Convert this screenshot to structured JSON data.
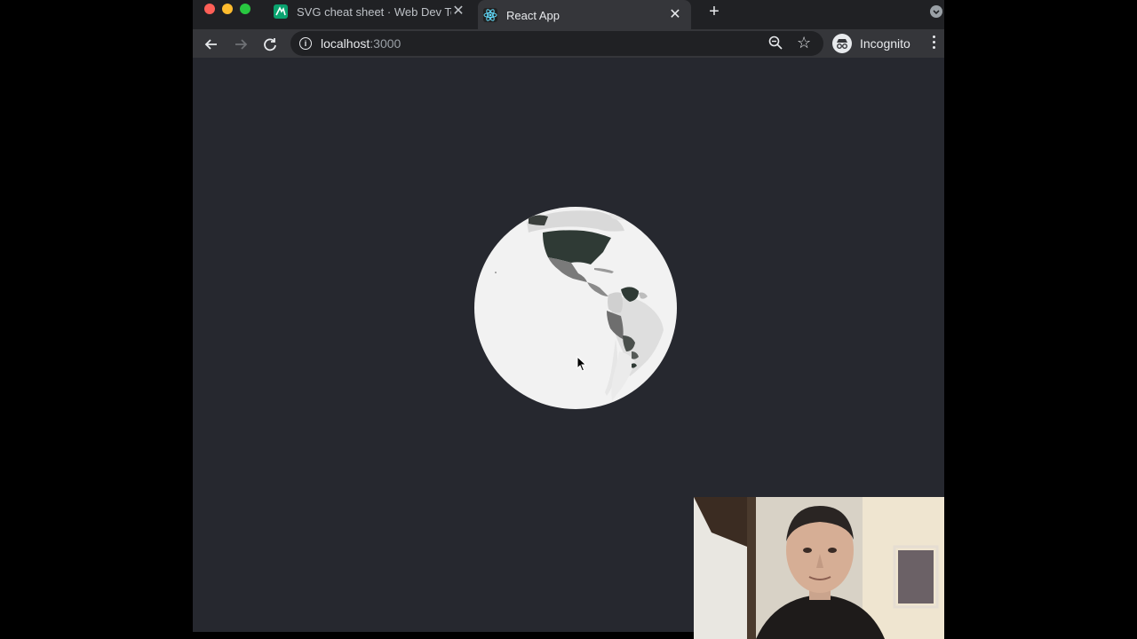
{
  "tabs": [
    {
      "title": "SVG cheat sheet · Web Dev To",
      "favicon": "code-favicon-icon",
      "active": false
    },
    {
      "title": "React App",
      "favicon": "react-favicon-icon",
      "active": true
    }
  ],
  "toolbar": {
    "url_host": "localhost",
    "url_port": ":3000",
    "profile_label": "Incognito"
  },
  "icons": {
    "back": "arrow-left-icon",
    "forward": "arrow-right-icon",
    "reload": "reload-icon",
    "info": "info-icon",
    "zoom": "zoom-icon",
    "bookmark": "star-icon",
    "incognito": "incognito-icon",
    "menu": "kebab-menu-icon",
    "tab_search": "tab-search-icon",
    "new_tab": "plus-icon",
    "close": "close-icon"
  },
  "colors": {
    "page_background": "#26282f",
    "globe_sphere": "#f2f2f2",
    "country_dark": "#2f3a35",
    "country_mid": "#7a7a7a",
    "country_light": "#d9d9d9"
  }
}
